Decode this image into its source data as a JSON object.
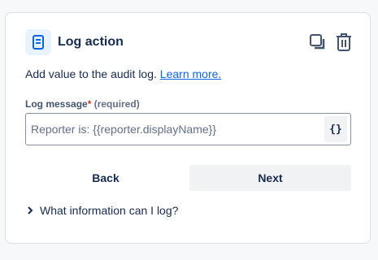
{
  "header": {
    "title": "Log action",
    "icon": "document-icon",
    "actions": [
      "duplicate-icon",
      "trash-icon"
    ]
  },
  "description": {
    "text": "Add value to the audit log.",
    "link": "Learn more."
  },
  "field": {
    "label": "Log message",
    "required_marker": "*",
    "required_text": "(required)",
    "placeholder": "Reporter is: {{reporter.displayName}}",
    "value": "",
    "smart_values_label": "{}"
  },
  "buttons": {
    "back": "Back",
    "next": "Next"
  },
  "expander": {
    "label": "What information can I log?"
  },
  "colors": {
    "link": "#0c66e4",
    "required": "#c9372c",
    "icon_bg": "#e9f2ff",
    "button_bg": "#f1f2f4"
  }
}
